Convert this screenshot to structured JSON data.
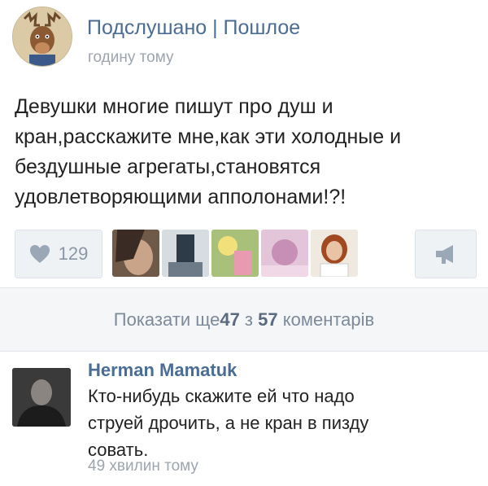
{
  "post": {
    "group_name": "Подслушано | Пошлое",
    "time": "годину тому",
    "text": "Девушки многие пишут про душ и\nкран,расскажите мне,как эти холодные и\nбездушные агрегаты,становятся\nудовлетворяющими апполонами!?!",
    "likes": "129",
    "icons": {
      "like": "heart-icon",
      "share": "megaphone-icon"
    }
  },
  "comments_bar": {
    "prefix": "Показати ще ",
    "shown": "47",
    "middle": " з ",
    "total": "57",
    "suffix": " коментарів"
  },
  "comment": {
    "author": "Herman Mamatuk",
    "text": "Кто-нибудь скажите ей что надо\nструей дрочить, а не кран в пизду\nсовать.",
    "time": "49 хвилин тому"
  },
  "colors": {
    "link": "#4b6d93",
    "muted": "#9ea5ad",
    "button_bg": "#eff2f5"
  }
}
